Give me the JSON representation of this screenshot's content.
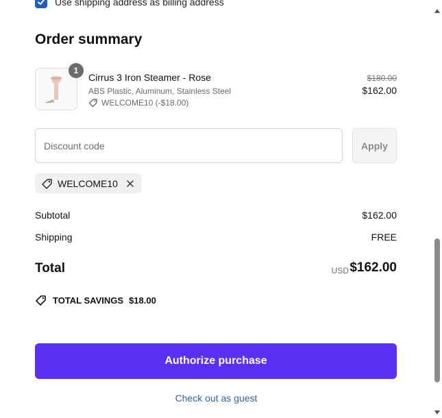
{
  "billing_checkbox": {
    "label": "Use shipping address as billing address",
    "checked": true
  },
  "order_summary": {
    "title": "Order summary",
    "item": {
      "quantity": "1",
      "name": "Cirrus 3 Iron Steamer - Rose",
      "variant": "ABS Plastic, Aluminum, Stainless Steel",
      "discount": "WELCOME10 (-$18.00)",
      "original_price": "$180.00",
      "price": "$162.00",
      "image_icon": "steamer-product-image"
    },
    "discount": {
      "placeholder": "Discount code",
      "value": "",
      "apply_label": "Apply",
      "applied_code": "WELCOME10"
    },
    "subtotal": {
      "label": "Subtotal",
      "value": "$162.00"
    },
    "shipping": {
      "label": "Shipping",
      "value": "FREE"
    },
    "total": {
      "label": "Total",
      "currency": "USD",
      "value": "$162.00"
    },
    "savings": {
      "label": "TOTAL SAVINGS",
      "value": "$18.00"
    }
  },
  "actions": {
    "authorize_label": "Authorize purchase",
    "guest_label": "Check out as guest"
  },
  "colors": {
    "accent": "#5a31f4",
    "checkbox": "#1f5fbf",
    "link": "#1f6aa5"
  }
}
